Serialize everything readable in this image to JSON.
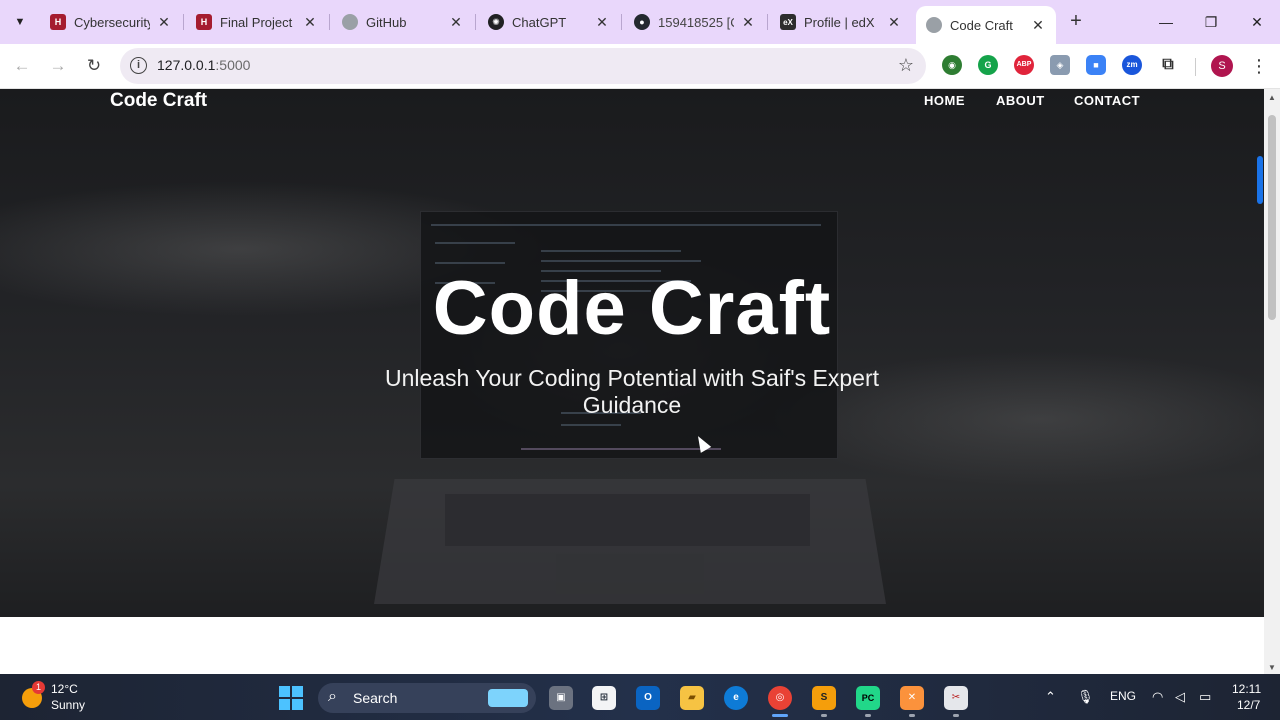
{
  "browser": {
    "tabs": [
      {
        "title": "Cybersecurity",
        "favicon": "harvard-shield-icon",
        "color": "#a51c30"
      },
      {
        "title": "Final Project -",
        "favicon": "harvard-shield-icon",
        "color": "#a51c30"
      },
      {
        "title": "GitHub",
        "favicon": "globe-icon",
        "color": "#9aa0a6"
      },
      {
        "title": "ChatGPT",
        "favicon": "openai-icon",
        "color": "#202123"
      },
      {
        "title": "159418525 [C",
        "favicon": "github-icon",
        "color": "#24292f"
      },
      {
        "title": "Profile | edX",
        "favicon": "edx-icon",
        "color": "#2d2d2d"
      },
      {
        "title": "Code Craft",
        "favicon": "globe-icon",
        "color": "#9aa0a6",
        "active": true
      }
    ],
    "url_host": "127.0.0.1",
    "url_port": ":5000",
    "profile_initial": "S",
    "accent": "#e9d7fb"
  },
  "site": {
    "brand": "Code Craft",
    "nav": [
      "HOME",
      "ABOUT",
      "CONTACT"
    ],
    "hero_title": "Code Craft",
    "hero_subtitle": "Unleash Your Coding Potential with Saif's Expert Guidance"
  },
  "taskbar": {
    "weather_temp": "12°C",
    "weather_cond": "Sunny",
    "weather_badge": "1",
    "search_label": "Search",
    "language": "ENG",
    "time": "12:11",
    "date": "12/7"
  }
}
